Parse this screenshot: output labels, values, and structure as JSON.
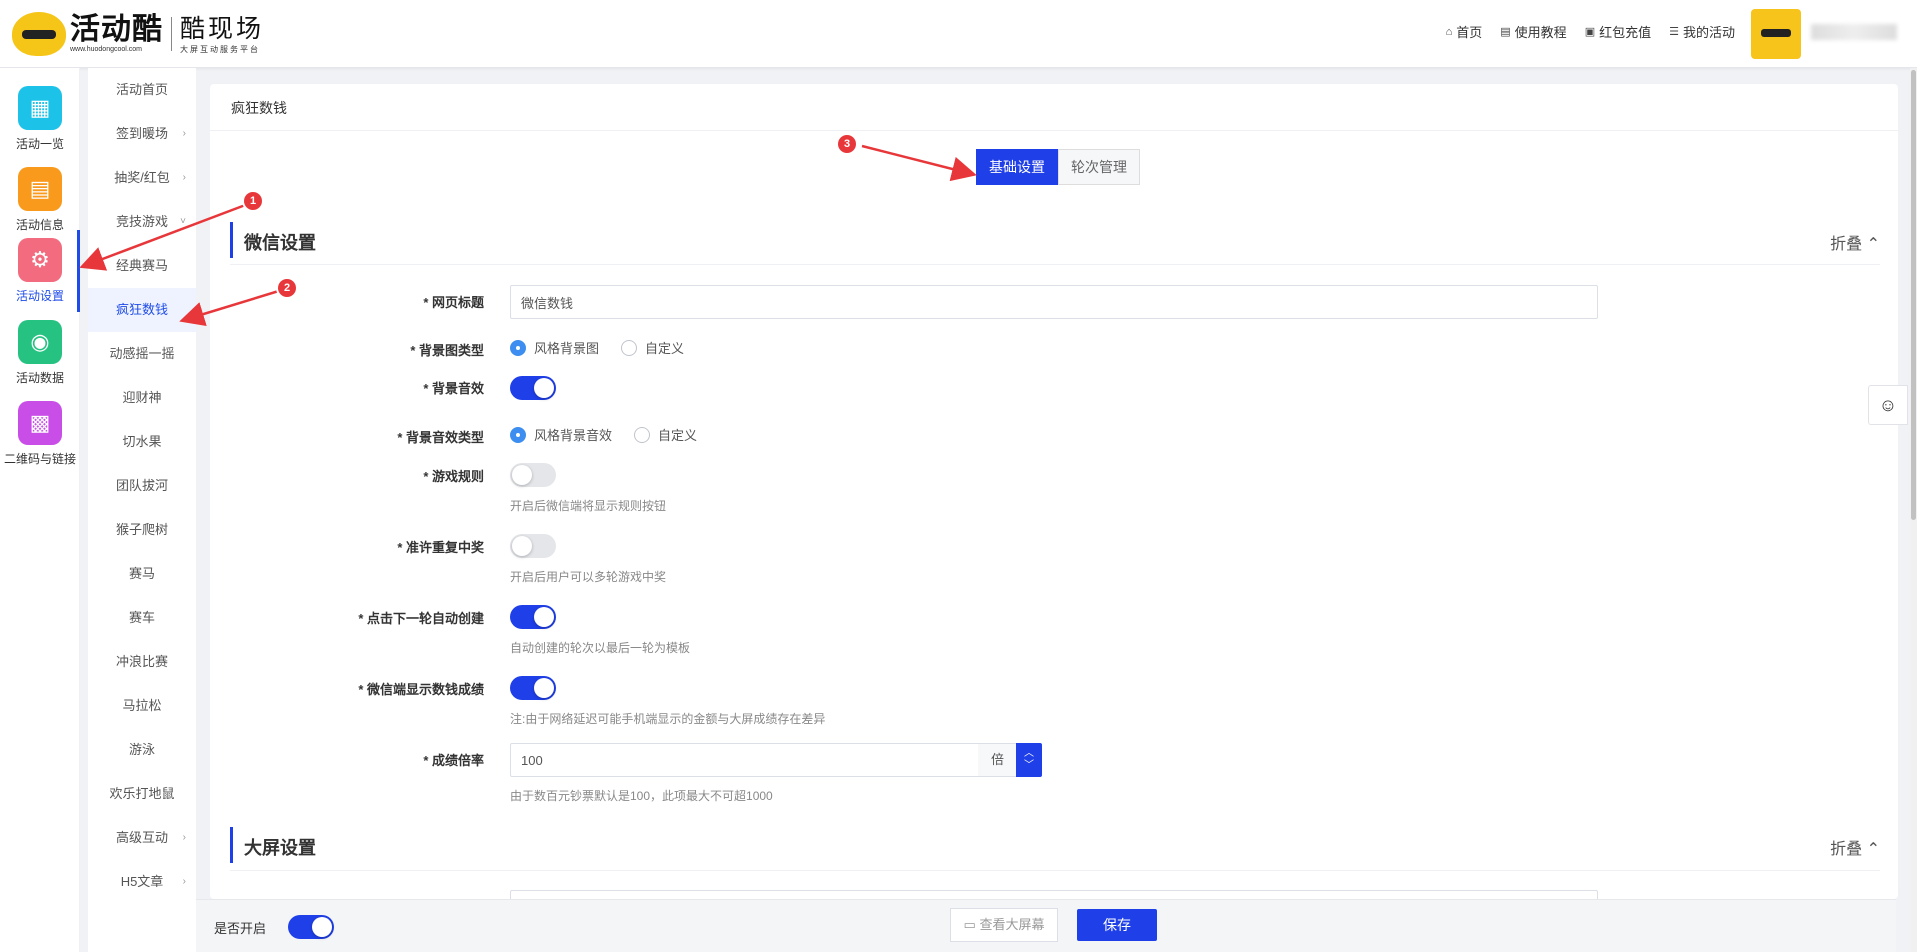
{
  "header": {
    "logo_text": "活动酷",
    "logo_url": "www.huodongcool.com",
    "brand_sub": "酷现场",
    "brand_sub_small": "大屏互动服务平台",
    "nav": [
      {
        "label": "首页",
        "icon": "home-icon"
      },
      {
        "label": "使用教程",
        "icon": "book-icon"
      },
      {
        "label": "红包充值",
        "icon": "wallet-icon"
      },
      {
        "label": "我的活动",
        "icon": "list-icon"
      }
    ]
  },
  "icon_sidebar": [
    {
      "label": "活动一览",
      "icon": "grid-icon",
      "color": "#1cc2e8"
    },
    {
      "label": "活动信息",
      "icon": "document-icon",
      "color": "#f99a1c"
    },
    {
      "label": "活动设置",
      "icon": "gear-icon",
      "color": "#f36b7e",
      "active": true
    },
    {
      "label": "活动数据",
      "icon": "database-icon",
      "color": "#26c281"
    },
    {
      "label": "二维码与链接",
      "icon": "qrcode-icon",
      "color": "#c94ee8"
    }
  ],
  "sub_menu": [
    {
      "label": "活动首页"
    },
    {
      "label": "签到暖场",
      "arrow": "›"
    },
    {
      "label": "抽奖/红包",
      "arrow": "›"
    },
    {
      "label": "竞技游戏",
      "arrow": "˅"
    },
    {
      "label": "经典赛马"
    },
    {
      "label": "疯狂数钱",
      "active": true
    },
    {
      "label": "动感摇一摇"
    },
    {
      "label": "迎财神"
    },
    {
      "label": "切水果"
    },
    {
      "label": "团队拔河"
    },
    {
      "label": "猴子爬树"
    },
    {
      "label": "赛马"
    },
    {
      "label": "赛车"
    },
    {
      "label": "冲浪比赛"
    },
    {
      "label": "马拉松"
    },
    {
      "label": "游泳"
    },
    {
      "label": "欢乐打地鼠"
    },
    {
      "label": "高级互动",
      "arrow": "›"
    },
    {
      "label": "H5文章",
      "arrow": "›"
    }
  ],
  "page": {
    "title": "疯狂数钱",
    "tabs": [
      {
        "label": "基础设置",
        "active": true
      },
      {
        "label": "轮次管理",
        "active": false
      }
    ]
  },
  "wechat_section": {
    "title": "微信设置",
    "fold": "折叠 ⌃",
    "fields": {
      "page_title": {
        "label": "* 网页标题",
        "value": "微信数钱"
      },
      "bg_type": {
        "label": "* 背景图类型",
        "options": [
          "风格背景图",
          "自定义"
        ],
        "selected": "风格背景图"
      },
      "bg_music": {
        "label": "* 背景音效",
        "on": true
      },
      "bg_music_type": {
        "label": "* 背景音效类型",
        "options": [
          "风格背景音效",
          "自定义"
        ],
        "selected": "风格背景音效"
      },
      "game_rules": {
        "label": "* 游戏规则",
        "on": false,
        "hint": "开启后微信端将显示规则按钮"
      },
      "repeat_win": {
        "label": "* 准许重复中奖",
        "on": false,
        "hint": "开启后用户可以多轮游戏中奖"
      },
      "auto_create": {
        "label": "* 点击下一轮自动创建",
        "on": true,
        "hint": "自动创建的轮次以最后一轮为模板"
      },
      "show_score": {
        "label": "* 微信端显示数钱成绩",
        "on": true,
        "hint": "注:由于网络延迟可能手机端显示的金额与大屏成绩存在差异"
      },
      "multiplier": {
        "label": "* 成绩倍率",
        "value": "100",
        "suffix": "倍",
        "hint": "由于数百元钞票默认是100，此项最大不可超1000"
      }
    }
  },
  "screen_section": {
    "title": "大屏设置",
    "fold": "折叠 ⌃"
  },
  "bottom_bar": {
    "enable_label": "是否开启",
    "enabled": true,
    "preview_label": "查看大屏幕",
    "save_label": "保存"
  },
  "annotations": [
    "1",
    "2",
    "3"
  ],
  "colors": {
    "accent": "#1f3fe8",
    "annotation": "#e8373a"
  }
}
